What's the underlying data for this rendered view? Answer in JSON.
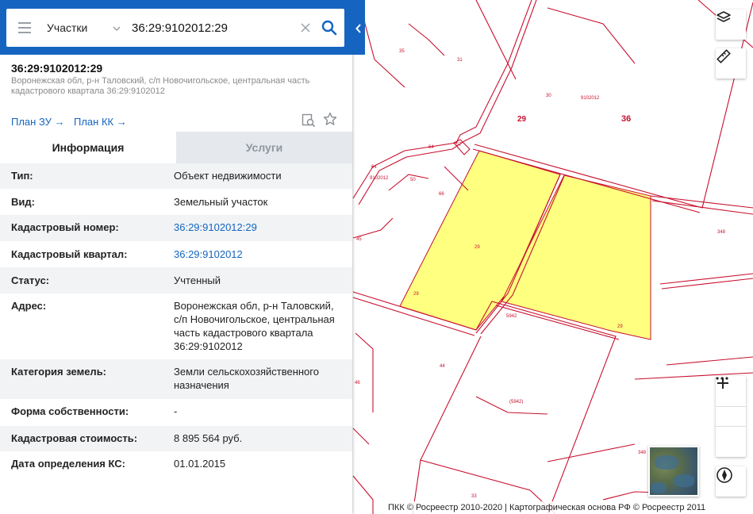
{
  "search": {
    "category": "Участки",
    "query": "36:29:9102012:29"
  },
  "object": {
    "title": "36:29:9102012:29",
    "address": "Воронежская обл, р-н Таловский, с/п Новочигольское, центральная часть кадастрового квартала 36:29:9102012",
    "links": [
      "План ЗУ",
      "План КК"
    ]
  },
  "tabs": [
    "Информация",
    "Услуги"
  ],
  "rows": [
    {
      "label": "Тип:",
      "value": "Объект недвижимости",
      "link": false
    },
    {
      "label": "Вид:",
      "value": "Земельный участок",
      "link": false
    },
    {
      "label": "Кадастровый номер:",
      "value": "36:29:9102012:29",
      "link": true
    },
    {
      "label": "Кадастровый квартал:",
      "value": "36:29:9102012",
      "link": true
    },
    {
      "label": "Статус:",
      "value": "Учтенный",
      "link": false
    },
    {
      "label": "Адрес:",
      "value": "Воронежская обл, р-н Таловский, с/п Новочигольское, центральная часть кадастрового квартала 36:29:9102012",
      "link": false
    },
    {
      "label": "Категория земель:",
      "value": "Земли сельскохозяйственного назначения",
      "link": false
    },
    {
      "label": "Форма собственности:",
      "value": "-",
      "link": false
    },
    {
      "label": "Кадастровая стоимость:",
      "value": "8 895 564 руб.",
      "link": false
    },
    {
      "label": "Дата определения КС:",
      "value": "01.01.2015",
      "link": false
    }
  ],
  "map": {
    "labels": {
      "q1": "9102012",
      "num29": "29",
      "num36": "36",
      "p35": "35",
      "p31": "31",
      "p30": "30",
      "p64": "64",
      "p57": "57",
      "p9102012b": "9102012",
      "p50": "50",
      "p66": "66",
      "p45": "45",
      "p29a": "29",
      "p29b": "29",
      "p29c": "29",
      "p5942": "5942",
      "p5942b": "(5942)",
      "p44": "44",
      "p46": "46",
      "p348": "348",
      "p348b": "348",
      "p33": "33"
    },
    "copyright": "ПКК © Росреестр 2010-2020 | Картографическая основа РФ © Росреестр 2011",
    "selected_fill": "#ffff80",
    "boundary_color": "#c8102e"
  }
}
